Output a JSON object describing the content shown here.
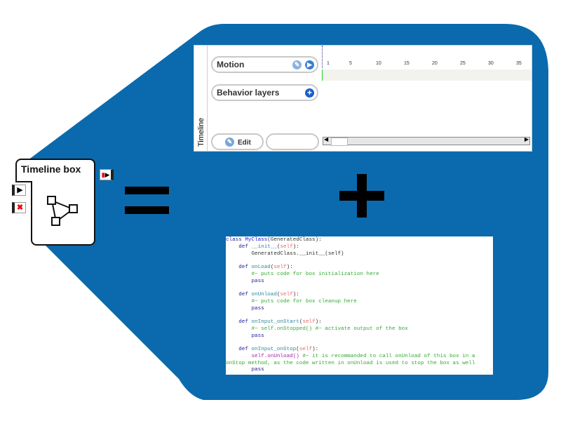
{
  "timeline": {
    "side_label": "Timeline",
    "motion_label": "Motion",
    "behavior_label": "Behavior layers",
    "edit_label": "Edit",
    "ruler": [
      "1",
      "5",
      "10",
      "15",
      "20",
      "25",
      "30",
      "35"
    ]
  },
  "box": {
    "title": "Timeline box"
  },
  "code": [
    [
      [
        "k",
        "class "
      ],
      [
        "n",
        "MyClass"
      ],
      [
        "t",
        "(GeneratedClass):"
      ]
    ],
    [
      [
        "k",
        "    def "
      ],
      [
        "f",
        "__init__"
      ],
      [
        "t",
        "("
      ],
      [
        "s",
        "self"
      ],
      [
        "t",
        "):"
      ]
    ],
    [
      [
        "t",
        "        GeneratedClass.__init__(self)"
      ]
    ],
    [
      [
        "t",
        ""
      ]
    ],
    [
      [
        "k",
        "    def "
      ],
      [
        "f",
        "onLoad"
      ],
      [
        "t",
        "("
      ],
      [
        "s",
        "self"
      ],
      [
        "t",
        "):"
      ]
    ],
    [
      [
        "c",
        "        #~ puts code for box initialization here"
      ]
    ],
    [
      [
        "k",
        "        pass"
      ]
    ],
    [
      [
        "t",
        ""
      ]
    ],
    [
      [
        "k",
        "    def "
      ],
      [
        "f",
        "onUnload"
      ],
      [
        "t",
        "("
      ],
      [
        "s",
        "self"
      ],
      [
        "t",
        "):"
      ]
    ],
    [
      [
        "c",
        "        #~ puts code for box cleanup here"
      ]
    ],
    [
      [
        "k",
        "        pass"
      ]
    ],
    [
      [
        "t",
        ""
      ]
    ],
    [
      [
        "k",
        "    def "
      ],
      [
        "f",
        "onInput_onStart"
      ],
      [
        "t",
        "("
      ],
      [
        "s",
        "self"
      ],
      [
        "t",
        "):"
      ]
    ],
    [
      [
        "c",
        "        #~ self.onStopped() #~ activate output of the box"
      ]
    ],
    [
      [
        "k",
        "        pass"
      ]
    ],
    [
      [
        "t",
        ""
      ]
    ],
    [
      [
        "k",
        "    def "
      ],
      [
        "f",
        "onInput_onStop"
      ],
      [
        "t",
        "("
      ],
      [
        "s",
        "self"
      ],
      [
        "t",
        "):"
      ]
    ],
    [
      [
        "p",
        "        self.onUnload()"
      ],
      [
        "c",
        " #~ it is recommanded to call onUnload of this box in a"
      ]
    ],
    [
      [
        "c",
        "onStop method, as the code written in onUnload is used to stop the box as well"
      ]
    ],
    [
      [
        "k",
        "        pass"
      ]
    ]
  ],
  "colors": {
    "background_shape": "#0a6aad"
  }
}
